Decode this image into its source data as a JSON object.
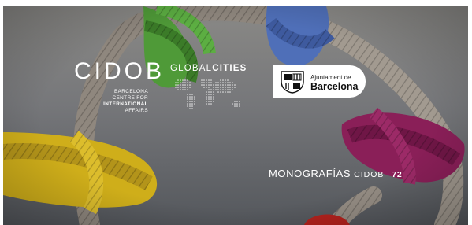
{
  "logo_cidob": {
    "name": "CIDOB",
    "tagline": [
      "BARCELONA",
      "CENTRE FOR",
      "INTERNATIONAL",
      "AFFAIRS"
    ]
  },
  "logo_globalcities": {
    "prefix": "GLOBAL",
    "suffix": "CITIES"
  },
  "logo_ajuntament": {
    "line1": "Ajuntament de",
    "line2": "Barcelona"
  },
  "series": {
    "label": "MONOGRAFÍAS",
    "brand": "CIDOB",
    "number": "72"
  },
  "colors": {
    "sky_top": "#8c8c89",
    "sky_bottom": "#5b5e63",
    "rope_green": "#4f9a38",
    "rope_blue": "#4f6fb8",
    "rope_magenta": "#8a1f58",
    "rope_yellow": "#d4b21c",
    "rope_grey": "#9a9088",
    "rope_red": "#b3221d"
  }
}
